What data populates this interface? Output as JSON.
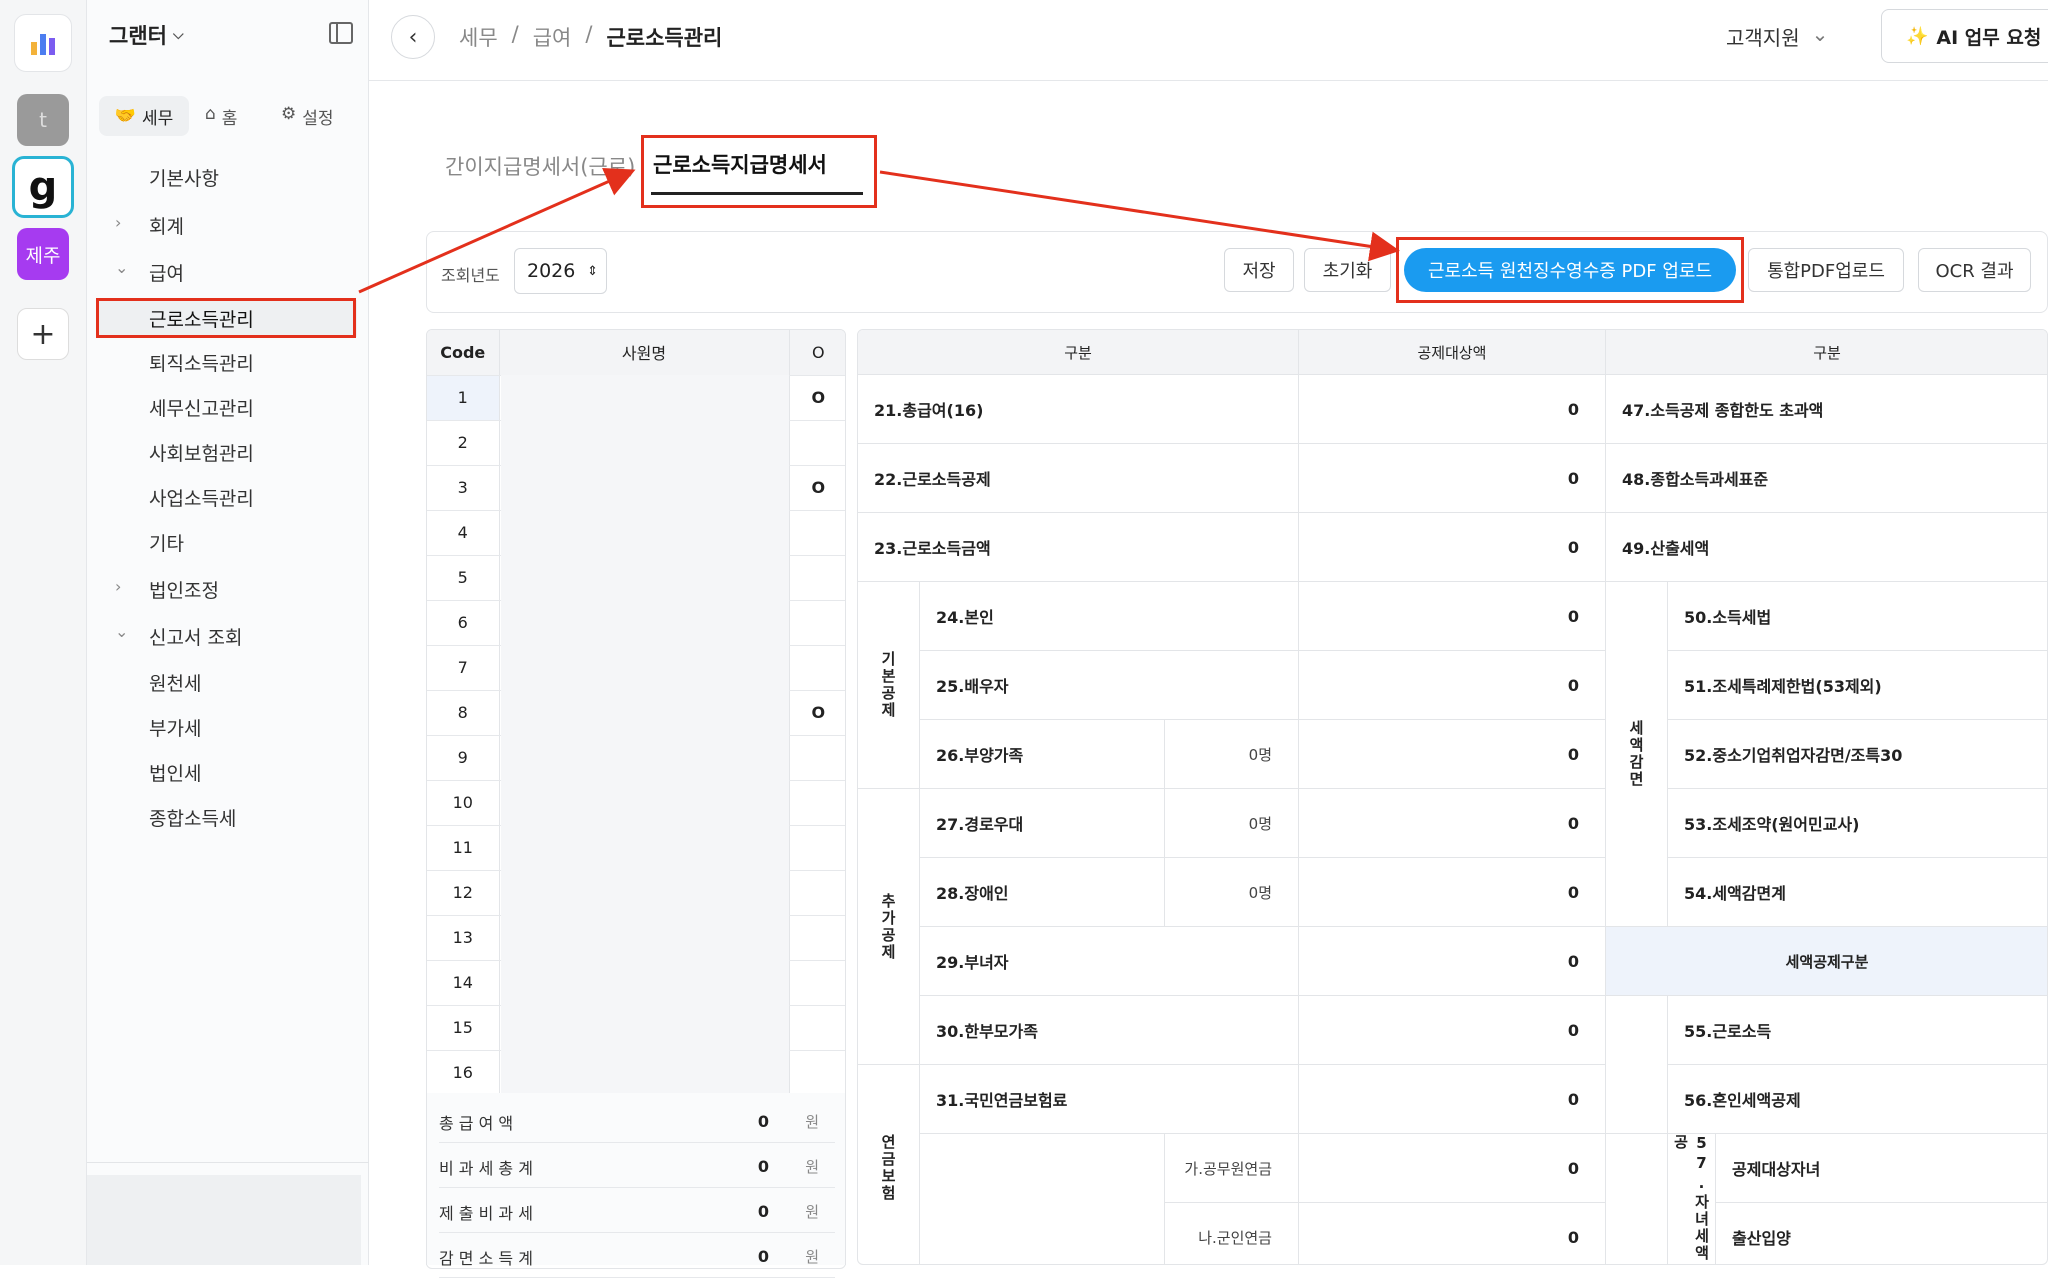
{
  "rail": {
    "t_label": "t",
    "g_label": "g",
    "jeju_label": "제주",
    "plus_label": "+"
  },
  "sidebar": {
    "workspace": "그랜터",
    "tabs": [
      {
        "label": "세무"
      },
      {
        "label": "홈"
      },
      {
        "label": "설정"
      }
    ],
    "menu": [
      {
        "label": "기본사항"
      },
      {
        "label": "회계"
      },
      {
        "label": "급여"
      },
      {
        "label": "근로소득관리"
      },
      {
        "label": "퇴직소득관리"
      },
      {
        "label": "세무신고관리"
      },
      {
        "label": "사회보험관리"
      },
      {
        "label": "사업소득관리"
      },
      {
        "label": "기타"
      },
      {
        "label": "법인조정"
      },
      {
        "label": "신고서 조회"
      },
      {
        "label": "원천세"
      },
      {
        "label": "부가세"
      },
      {
        "label": "법인세"
      },
      {
        "label": "종합소득세"
      }
    ]
  },
  "topbar": {
    "crumbs": [
      "세무",
      "급여",
      "근로소득관리"
    ],
    "sep": "/",
    "support": "고객지원",
    "ai_button": "AI 업무 요청"
  },
  "tabs": [
    {
      "label": "간이지급명세서(근로)"
    },
    {
      "label": "근로소득지급명세서"
    }
  ],
  "toolbar": {
    "year_label": "조회년도",
    "year_value": "2026",
    "save": "저장",
    "reset": "초기화",
    "upload": "근로소득 원천징수영수증 PDF 업로드",
    "merged": "통합PDF업로드",
    "ocr": "OCR 결과"
  },
  "emp_table": {
    "headers": [
      "Code",
      "사원명",
      "O"
    ],
    "rows": [
      {
        "code": "1",
        "o": "O"
      },
      {
        "code": "2",
        "o": ""
      },
      {
        "code": "3",
        "o": "O"
      },
      {
        "code": "4",
        "o": ""
      },
      {
        "code": "5",
        "o": ""
      },
      {
        "code": "6",
        "o": ""
      },
      {
        "code": "7",
        "o": ""
      },
      {
        "code": "8",
        "o": "O"
      },
      {
        "code": "9",
        "o": ""
      },
      {
        "code": "10",
        "o": ""
      },
      {
        "code": "11",
        "o": ""
      },
      {
        "code": "12",
        "o": ""
      },
      {
        "code": "13",
        "o": ""
      },
      {
        "code": "14",
        "o": ""
      },
      {
        "code": "15",
        "o": ""
      },
      {
        "code": "16",
        "o": ""
      }
    ],
    "summary": [
      {
        "label": "총 급 여 액",
        "value": "0",
        "unit": "원"
      },
      {
        "label": "비 과 세 총 계",
        "value": "0",
        "unit": "원"
      },
      {
        "label": "제 출 비 과 세",
        "value": "0",
        "unit": "원"
      },
      {
        "label": "감 면 소 득 계",
        "value": "0",
        "unit": "원"
      }
    ]
  },
  "grid": {
    "h_left": "구분",
    "h_amount": "공제대상액",
    "h_right": "구분",
    "zero": "0",
    "zero_people": "0명",
    "g_basic": "기본공제",
    "g_extra": "추가공제",
    "g_pension": "연금보험",
    "g_reduce": "세액감면",
    "g_child": "57.자녀세액공",
    "rows": {
      "r21": "21.총급여(16)",
      "r22": "22.근로소득공제",
      "r23": "23.근로소득금액",
      "r24": "24.본인",
      "r25": "25.배우자",
      "r26": "26.부양가족",
      "r27": "27.경로우대",
      "r28": "28.장애인",
      "r29": "29.부녀자",
      "r30": "30.한부모가족",
      "r31": "31.국민연금보험료",
      "ga": "가.공무원연금",
      "na": "나.군인연금"
    },
    "right": {
      "r47": "47.소득공제 종합한도 초과액",
      "r48": "48.종합소득과세표준",
      "r49": "49.산출세액",
      "r50": "50.소득세법",
      "r51": "51.조세특례제한법(53제외)",
      "r52": "52.중소기업취업자감면/조특30",
      "r53": "53.조세조약(원어민교사)",
      "r54": "54.세액감면계",
      "tax_credit": "세액공제구분",
      "r55": "55.근로소득",
      "r56": "56.혼인세액공제",
      "child_target": "공제대상자녀",
      "birth": "출산입양"
    }
  },
  "colors": {
    "accent": "#1a9bf0",
    "annotation": "#e3301c"
  }
}
